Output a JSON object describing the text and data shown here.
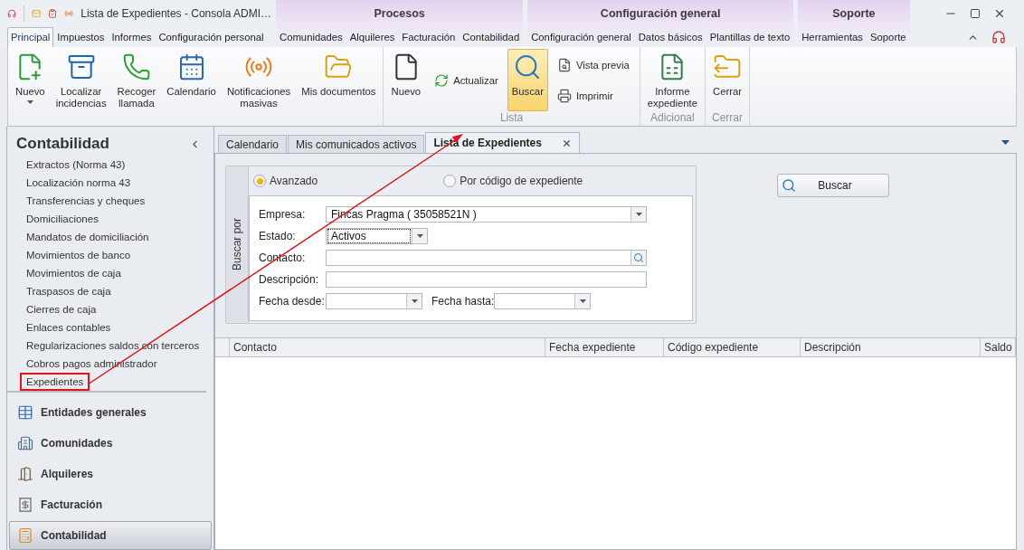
{
  "window": {
    "title": "Lista de Expedientes - Consola ADMI…"
  },
  "ribbon": {
    "tab_groups": [
      {
        "tabs": [
          {
            "label": "Principal",
            "selected": true
          },
          {
            "label": "Impuestos",
            "selected": false
          },
          {
            "label": "Informes",
            "selected": false
          },
          {
            "label": "Configuración personal",
            "selected": false
          }
        ]
      },
      {
        "header": "Procesos",
        "tabs": [
          {
            "label": "Comunidades",
            "selected": false
          },
          {
            "label": "Alquileres",
            "selected": false
          },
          {
            "label": "Facturación",
            "selected": false
          },
          {
            "label": "Contabilidad",
            "selected": false
          }
        ]
      },
      {
        "header": "Configuración general",
        "tabs": [
          {
            "label": "Configuración general",
            "selected": false
          },
          {
            "label": "Datos básicos",
            "selected": false
          },
          {
            "label": "Plantillas de texto",
            "selected": false
          }
        ]
      },
      {
        "header": "Soporte",
        "tabs": [
          {
            "label": "Herramientas",
            "selected": false
          },
          {
            "label": "Soporte",
            "selected": false
          }
        ]
      }
    ],
    "groups": [
      {
        "buttons": [
          {
            "label": "Nuevo",
            "kind": "dropdown",
            "selected": false
          },
          {
            "label": "Localizar\nincidencias",
            "kind": "large",
            "selected": false
          },
          {
            "label": "Recoger\nllamada",
            "kind": "large",
            "selected": false
          },
          {
            "label": "Calendario",
            "kind": "large",
            "selected": false
          },
          {
            "label": "Notificaciones\nmasivas",
            "kind": "large",
            "selected": false
          },
          {
            "label": "Mis documentos",
            "kind": "large",
            "selected": false
          }
        ]
      },
      {
        "label": "Lista",
        "buttons": [
          {
            "label": "Nuevo",
            "kind": "large",
            "selected": false
          },
          {
            "label": "Actualizar",
            "kind": "small",
            "selected": false
          },
          {
            "label": "Buscar",
            "kind": "large",
            "selected": true
          },
          {
            "label": "Vista previa",
            "kind": "small",
            "selected": false
          },
          {
            "label": "Imprimir",
            "kind": "small",
            "selected": false
          }
        ]
      },
      {
        "label": "Adicional",
        "buttons": [
          {
            "label": "Informe\nexpediente",
            "kind": "large",
            "selected": false
          }
        ]
      },
      {
        "label": "Cerrar",
        "buttons": [
          {
            "label": "Cerrar",
            "kind": "large",
            "selected": false
          }
        ]
      }
    ]
  },
  "sidebar": {
    "title": "Contabilidad",
    "items": [
      {
        "label": "Extractos (Norma 43)",
        "annotated": false
      },
      {
        "label": "Localización norma 43",
        "annotated": false
      },
      {
        "label": "Transferencias y cheques",
        "annotated": false
      },
      {
        "label": "Domiciliaciones",
        "annotated": false
      },
      {
        "label": "Mandatos de domiciliación",
        "annotated": false
      },
      {
        "label": "Movimientos de banco",
        "annotated": false
      },
      {
        "label": "Movimientos de caja",
        "annotated": false
      },
      {
        "label": "Traspasos de caja",
        "annotated": false
      },
      {
        "label": "Cierres de caja",
        "annotated": false
      },
      {
        "label": "Enlaces contables",
        "annotated": false
      },
      {
        "label": "Regularizaciones saldos con terceros",
        "annotated": false
      },
      {
        "label": "Cobros pagos administrador",
        "annotated": false
      },
      {
        "label": "Expedientes",
        "annotated": true
      }
    ],
    "nav": [
      {
        "label": "Entidades generales",
        "selected": false
      },
      {
        "label": "Comunidades",
        "selected": false
      },
      {
        "label": "Alquileres",
        "selected": false
      },
      {
        "label": "Facturación",
        "selected": false
      },
      {
        "label": "Contabilidad",
        "selected": true
      }
    ]
  },
  "document_tabs": [
    {
      "label": "Calendario",
      "selected": false,
      "closable": false
    },
    {
      "label": "Mis comunicados activos",
      "selected": false,
      "closable": false
    },
    {
      "label": "Lista de Expedientes",
      "selected": true,
      "closable": true
    }
  ],
  "search": {
    "group_label": "Buscar por",
    "modes": [
      {
        "label": "Avanzado",
        "selected": true
      },
      {
        "label": "Por código de expediente",
        "selected": false
      }
    ],
    "rows": [
      [
        {
          "label": "Empresa:",
          "kind": "combo",
          "value": "Fincas Pragma ( 35058521N )",
          "focused": false
        }
      ],
      [
        {
          "label": "Estado:",
          "kind": "combo",
          "value": "Activos",
          "focused": true
        }
      ],
      [
        {
          "label": "Contacto:",
          "kind": "lookup",
          "focused": false
        }
      ],
      [
        {
          "label": "Descripción:",
          "kind": "text",
          "focused": false
        }
      ],
      [
        {
          "label": "Fecha desde:",
          "kind": "combo",
          "focused": false
        },
        {
          "label": "Fecha hasta:",
          "kind": "combo",
          "focused": false
        }
      ]
    ],
    "button": "Buscar"
  },
  "table": {
    "columns": [
      "Contacto",
      "Fecha expediente",
      "Código expediente",
      "Descripción",
      "Saldo"
    ]
  }
}
